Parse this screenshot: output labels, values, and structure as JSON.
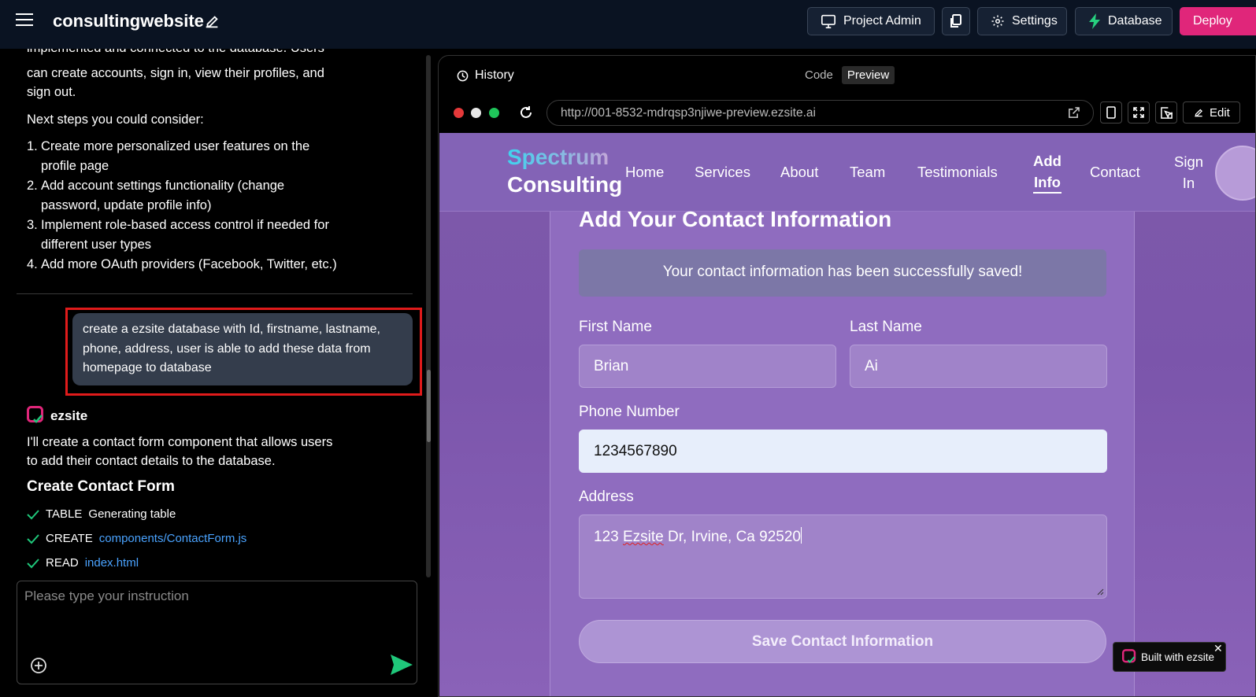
{
  "app": {
    "title": "consultingwebsite"
  },
  "toolbar": {
    "project_admin": "Project Admin",
    "settings": "Settings",
    "database": "Database",
    "deploy": "Deploy"
  },
  "chat": {
    "partial_line": "implemented and connected to the database. Users",
    "intro_lines": [
      "can create accounts, sign in, view their profiles, and",
      "sign out."
    ],
    "next_steps_heading": "Next steps you could consider:",
    "steps": [
      {
        "num": "1.",
        "lines": [
          "Create more personalized user features on the",
          "profile page"
        ]
      },
      {
        "num": "2.",
        "lines": [
          "Add account settings functionality (change",
          "password, update profile info)"
        ]
      },
      {
        "num": "3.",
        "lines": [
          "Implement role-based access control if needed for",
          "different user types"
        ]
      },
      {
        "num": "4.",
        "lines": [
          "Add more OAuth providers (Facebook, Twitter, etc.)"
        ]
      }
    ],
    "user_message_lines": [
      "create a ezsite database with Id, firstname, lastname,",
      "phone, address, user is able to add these data from",
      "homepage to database"
    ],
    "assistant_name": "ezsite",
    "assistant_reply_lines": [
      "I'll create a contact form component that allows users",
      "to add their contact details to the database."
    ],
    "section_heading": "Create Contact Form",
    "tasks": [
      {
        "kind": "TABLE",
        "detail": "Generating table"
      },
      {
        "kind": "CREATE",
        "detail": "components/ContactForm.js"
      },
      {
        "kind": "READ",
        "detail": "index.html"
      }
    ],
    "input_placeholder": "Please type your instruction"
  },
  "preview": {
    "history_label": "History",
    "tab_code": "Code",
    "tab_preview": "Preview",
    "url": "http://001-8532-mdrqsp3njiwe-preview.ezsite.ai",
    "edit_label": "Edit"
  },
  "site": {
    "brand_line1": "Spectrum",
    "brand_line2": "Consulting",
    "nav": {
      "home": "Home",
      "services": "Services",
      "about": "About",
      "team": "Team",
      "testimonials": "Testimonials",
      "add_info_1": "Add",
      "add_info_2": "Info",
      "contact": "Contact",
      "sign_in_1": "Sign",
      "sign_in_2": "In"
    },
    "form": {
      "title": "Add Your Contact Information",
      "success_message": "Your contact information has been successfully saved!",
      "first_name_label": "First Name",
      "first_name_value": "Brian",
      "last_name_label": "Last Name",
      "last_name_value": "Ai",
      "phone_label": "Phone Number",
      "phone_value": "1234567890",
      "address_label": "Address",
      "address_part1": "123 ",
      "address_part2": "Ezsite",
      "address_part3": " Dr, Irvine, Ca 92520",
      "submit_label": "Save Contact Information"
    },
    "badge": "Built with ezsite"
  },
  "colors": {
    "topbar_bg": "#0a1322",
    "deploy_accent": "#e0267a",
    "highlight_border": "#e01b1b",
    "link": "#4aa3ff",
    "check": "#1fc77a",
    "site_purple": "#7e5aaa"
  },
  "icons": [
    "menu-icon",
    "pencil-icon",
    "monitor-icon",
    "copy-icon",
    "gear-icon",
    "bolt-icon",
    "history-icon",
    "reload-icon",
    "external-link-icon",
    "mobile-icon",
    "fullscreen-icon",
    "select-element-icon",
    "check-icon",
    "plus-circle-icon",
    "send-icon",
    "ezsite-logo-icon",
    "close-icon"
  ]
}
